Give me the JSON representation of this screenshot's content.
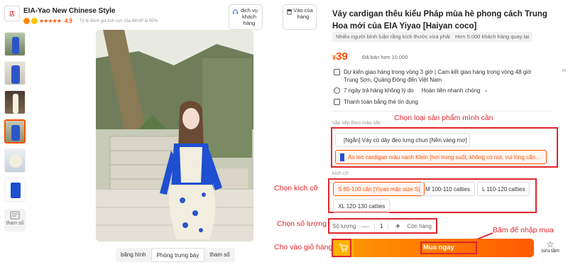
{
  "store": {
    "logo_text": "店",
    "name": "EIA-Yao New Chinese Style",
    "stars": "★★★★★",
    "rating": "4.9",
    "subtitle": "Tỷ lệ đánh giá tích cực của 88VIP là 95%"
  },
  "service_buttons": [
    {
      "label": "dịch vụ khách hàng",
      "icon": "headset-icon"
    },
    {
      "label": "Vào của hàng",
      "icon": "store-icon"
    }
  ],
  "gallery": {
    "thumb_count": 6,
    "params_label": "tham số",
    "tabs": [
      "băng hình",
      "Phòng trưng bày",
      "tham số"
    ],
    "active_tab": 1
  },
  "product": {
    "title": "Váy cardigan thêu kiểu Pháp mùa hè phong cách Trung Hoa mới của EIA Yiyao [Haiyan coco]",
    "tags": [
      "Nhiều người bình luận rằng kích thước vừa phải",
      "Hơn 5.000 khách hàng quay lại"
    ],
    "currency": "¥",
    "price": "39",
    "sold": "Đã bán hơn 10.000",
    "delivery": "Dự kiến giao hàng trong vòng 3 giờ | Cam kết giao hàng trong vòng 48 giờ Trung Sơn, Quảng Đông đến Việt Nam",
    "returns": "7 ngày trả hàng không lý do",
    "refund": "Hoàn tiền nhanh chóng",
    "credit": "Thanh toán bằng thẻ tín dụng"
  },
  "variant": {
    "section_label": "sắp xếp theo màu sắc",
    "options": [
      "[Ngắn] Váy có dây đeo lưng chun [Nền vàng mơ]",
      "Áo len cardigan màu xanh Klein [hơi trong suốt, không có nút, vui lòng cẩn thận]"
    ],
    "selected": 1
  },
  "size": {
    "section_label": "kích cỡ",
    "options": [
      "S 85-100 cân [Yiyao mặc size S]",
      "M 100-110 catties",
      "L 110-120 catties",
      "XL 120-130 catties"
    ],
    "selected": 0
  },
  "quantity": {
    "label": "Số lượng",
    "minus": "—",
    "value": "1",
    "plus": "+",
    "stock": "Còn hàng"
  },
  "actions": {
    "buy_now": "Mua ngay",
    "save": "sưu tầm"
  },
  "side_text": "Hi",
  "annotations": {
    "variant": "Chọn loại sản phẩm mình cần",
    "size": "Chọn kích cỡ",
    "quantity": "Chọn số lượng",
    "buy": "Bấm để nhập mua",
    "cart": "Cho vào giỏ hàng"
  },
  "colors": {
    "accent": "#ff5000",
    "annotation_red": "#e0262c",
    "buy_gradient_start": "#ff9a00",
    "buy_gradient_end": "#ff5a00",
    "cart_yellow": "#ffb300",
    "dress_blue": "#1f4fd1"
  }
}
